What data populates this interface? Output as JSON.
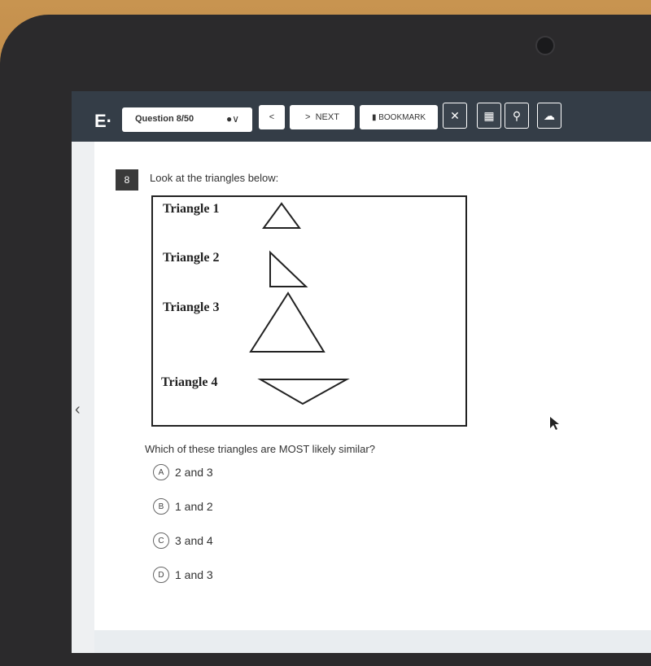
{
  "toolbar": {
    "logo": "E·",
    "question_selector": "Question 8/50",
    "info_icon": "i",
    "prev_label": "<",
    "next_label": "NEXT",
    "bookmark_label": "BOOKMARK",
    "icons": [
      "close-icon",
      "calendar-icon",
      "magnifier-icon",
      "cloud-upload-icon"
    ]
  },
  "question": {
    "number": "8",
    "prompt": "Look at the triangles below:",
    "figure_labels": [
      "Triangle 1",
      "Triangle 2",
      "Triangle 3",
      "Triangle 4"
    ],
    "text": "Which of these triangles are MOST likely similar?",
    "options": [
      {
        "letter": "A",
        "text": "2 and 3"
      },
      {
        "letter": "B",
        "text": "1 and 2"
      },
      {
        "letter": "C",
        "text": "3 and 4"
      },
      {
        "letter": "D",
        "text": "1 and 3"
      }
    ]
  },
  "nav": {
    "back_icon": "‹"
  }
}
